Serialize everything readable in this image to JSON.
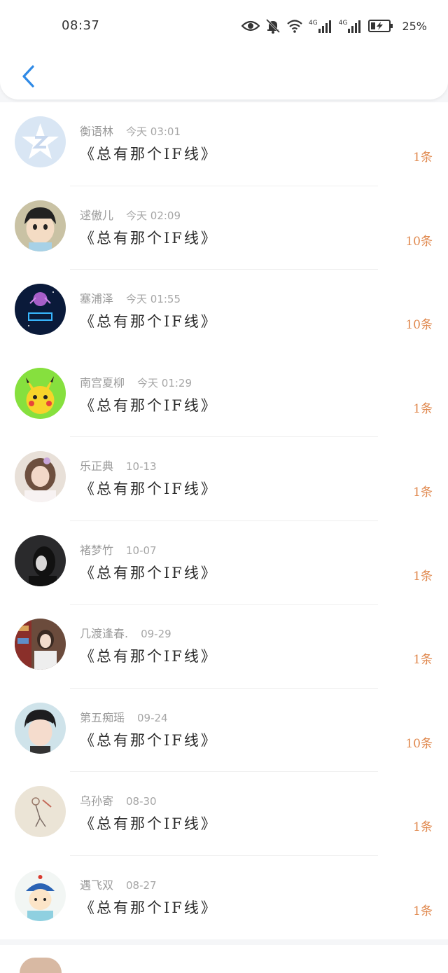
{
  "status_bar": {
    "time": "08:37",
    "network_1": "4G",
    "network_2": "4G",
    "battery": "25%"
  },
  "nav": {
    "back_icon": "chevron-left-icon",
    "accent": "#2f8ae6"
  },
  "colors": {
    "count": "#e0894f"
  },
  "messages": [
    {
      "name": "衡语林",
      "time": "今天  03:01",
      "title": "《总有那个IF线》",
      "count": "1条"
    },
    {
      "name": "逑傲儿",
      "time": "今天  02:09",
      "title": "《总有那个IF线》",
      "count": "10条"
    },
    {
      "name": "塞浦泽",
      "time": "今天  01:55",
      "title": "《总有那个IF线》",
      "count": "10条"
    },
    {
      "name": "南宫夏柳",
      "time": "今天  01:29",
      "title": "《总有那个IF线》",
      "count": "1条"
    },
    {
      "name": "乐正典",
      "time": "10-13",
      "title": "《总有那个IF线》",
      "count": "1条"
    },
    {
      "name": "褚梦竹",
      "time": "10-07",
      "title": "《总有那个IF线》",
      "count": "1条"
    },
    {
      "name": "几渡逢春.",
      "time": "09-29",
      "title": "《总有那个IF线》",
      "count": "1条"
    },
    {
      "name": "第五痴瑶",
      "time": "09-24",
      "title": "《总有那个IF线》",
      "count": "10条"
    },
    {
      "name": "乌孙寄",
      "time": "08-30",
      "title": "《总有那个IF线》",
      "count": "1条"
    },
    {
      "name": "遇飞双",
      "time": "08-27",
      "title": "《总有那个IF线》",
      "count": "1条"
    }
  ]
}
